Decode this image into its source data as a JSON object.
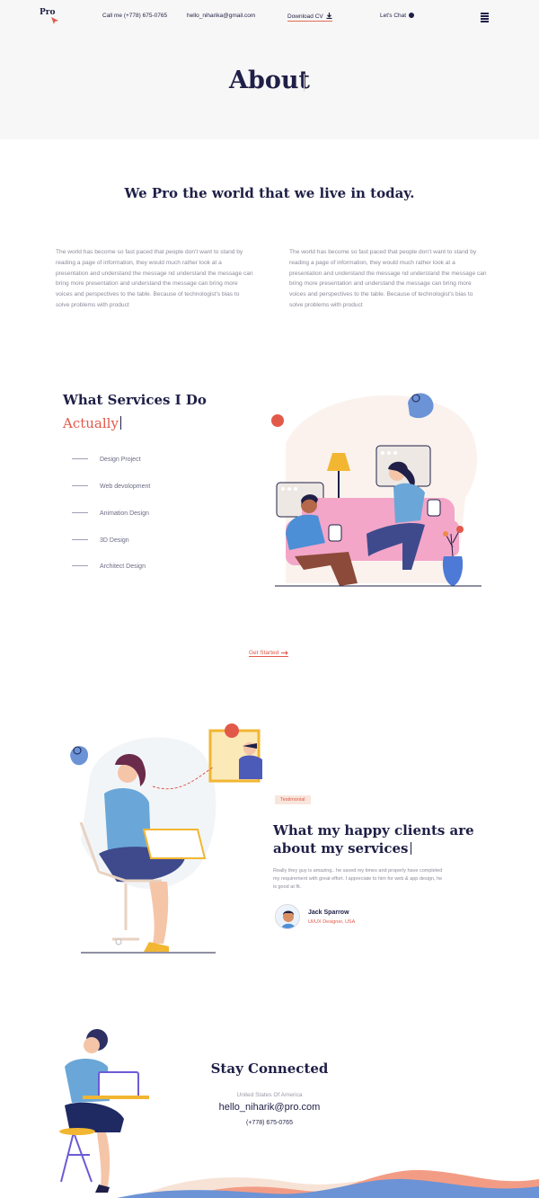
{
  "header": {
    "logo": "Pro",
    "phone": "Call me (+778) 675-0765",
    "email": "hello_niharika@gmail.com",
    "download_cv": "Download CV",
    "lets_chat": "Let's Chat"
  },
  "hero": {
    "title": "About"
  },
  "intro": {
    "title": "We Pro the world that we live in today.",
    "paragraph_left": "The world has become so fast paced that people don’t want to stand by reading a page of information, they would much rather look at a presentation and understand the message nd understand the message can bring more presentation and understand the message can bring more voices and perspectives to the table. Because of technologist’s bias to solve problems with product",
    "paragraph_right": "The world has become so fast paced that people don’t want to stand by reading a page of information, they would much rather look at a presentation and understand the message nd understand the message can bring more presentation and understand the message can bring more voices and perspectives to the table. Because of technologist’s bias to solve problems with product"
  },
  "services": {
    "title": "What Services I Do",
    "accent": "Actually",
    "items": [
      "Design Project",
      "Web devolopment",
      "Animation Design",
      "3D Design",
      "Architect Design"
    ],
    "cta": "Get Started"
  },
  "testimonial": {
    "badge": "Testimonial",
    "title": "What my happy clients are about my services",
    "text": "Really they guy is amazing.. he saved my times and properly have completed my requirement with great effort. I appreciate to him for web & app design, he is good at fit.",
    "client_name": "Jack Sparrow",
    "client_role": "UI/UX Designer, USA"
  },
  "contact": {
    "title": "Stay Connected",
    "country": "United States Of America",
    "email": "hello_niharik@pro.com",
    "phone": "(+778) 675-0765"
  },
  "colors": {
    "navy": "#1f1f47",
    "accent_red": "#e2594a",
    "text_gray": "#8b8b9b",
    "hero_bg": "#f7f7f7"
  },
  "icons": [
    "download-icon",
    "chat-icon",
    "menu-icon",
    "arrow-right-icon"
  ]
}
